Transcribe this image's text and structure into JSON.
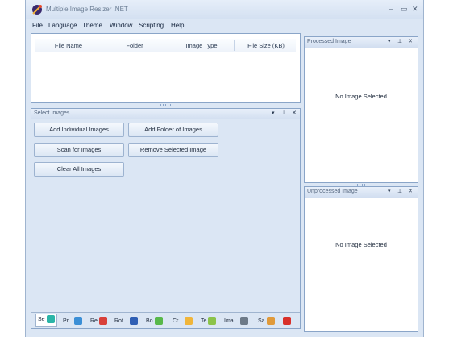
{
  "window": {
    "title": "Multiple Image Resizer .NET",
    "controls": {
      "minimize": "–",
      "maximize": "▭",
      "close": "✕"
    }
  },
  "menu": [
    "File",
    "Language",
    "Theme",
    "Window",
    "Scripting",
    "Help"
  ],
  "file_list": {
    "columns": [
      "File Name",
      "Folder",
      "Image Type",
      "File Size (KB)"
    ]
  },
  "select_panel": {
    "title": "Select Images",
    "buttons": {
      "add_individual": "Add Individual Images",
      "add_folder": "Add Folder of Images",
      "scan": "Scan for Images",
      "remove_selected": "Remove Selected Image",
      "clear_all": "Clear All Images"
    }
  },
  "processed_panel": {
    "title": "Processed Image",
    "message": "No Image Selected"
  },
  "unprocessed_panel": {
    "title": "Unprocessed Image",
    "message": "No Image Selected"
  },
  "panel_controls": {
    "dropdown": "▾",
    "pin": "⊥",
    "close": "✕"
  },
  "tabs": [
    {
      "label": "Se",
      "color": "#2bb5a8"
    },
    {
      "label": "Pr...",
      "color": "#3b8fd6"
    },
    {
      "label": "Re",
      "color": "#d8403a"
    },
    {
      "label": "Rot...",
      "color": "#2f5fb4"
    },
    {
      "label": "Bo",
      "color": "#58b84a"
    },
    {
      "label": "Cr...",
      "color": "#f0b53a"
    },
    {
      "label": "Te",
      "color": "#8bc34a"
    },
    {
      "label": "Ima...",
      "color": "#6d7a88"
    },
    {
      "label": "Sa",
      "color": "#e09a3a"
    },
    {
      "label": "",
      "color": "#d8302a"
    }
  ]
}
